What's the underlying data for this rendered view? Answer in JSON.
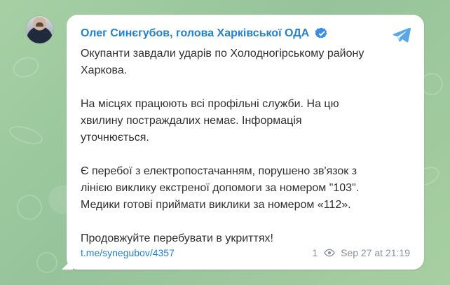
{
  "post": {
    "author": "Олег Синєгубов, голова Харківської ОДА",
    "paragraphs": [
      "Окупанти завдали ударів по Холодногірському району\nХаркова.",
      "На місцях працюють всі профільні служби. На цю\nхвилину постраждалих немає. Інформація\nуточнюється.",
      "Є перебої з електропостачанням, порушено зв'язок з\nлінією виклику екстреної допомоги за номером \"103\".\nМедики готові приймати виклики за номером «112».",
      "Продовжуйте перебувати в укриттях!"
    ],
    "link": "t.me/synegubov/4357",
    "views": "1",
    "timestamp": "Sep 27 at 21:19"
  },
  "colors": {
    "accent": "#2481cc",
    "background": "#9bc59a",
    "bubble": "#ffffff",
    "text": "#303030",
    "meta": "#8a8f98"
  },
  "icons": {
    "verified": "verified-icon",
    "share": "telegram-share-icon",
    "views": "eye-icon"
  }
}
